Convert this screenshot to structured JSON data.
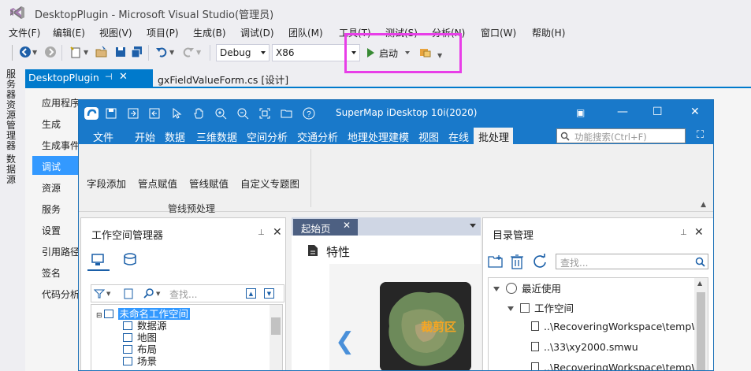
{
  "vs": {
    "title": "DesktopPlugin - Microsoft Visual Studio(管理员)",
    "menu": [
      "文件(F)",
      "编辑(E)",
      "视图(V)",
      "项目(P)",
      "生成(B)",
      "调试(D)",
      "团队(M)",
      "工具(T)",
      "测试(S)",
      "分析(N)",
      "窗口(W)",
      "帮助(H)"
    ],
    "toolbar": {
      "config": "Debug",
      "platform": "X86",
      "run_label": "启动"
    },
    "side_toolbox": [
      "服务器资源管理器",
      "数据源"
    ],
    "tabs": {
      "active": "DesktopPlugin",
      "other": "gxFieldValueForm.cs [设计]"
    },
    "project_nav": [
      "应用程序",
      "生成",
      "生成事件",
      "调试",
      "资源",
      "服务",
      "设置",
      "引用路径",
      "签名",
      "代码分析"
    ],
    "project_nav_selected": 3
  },
  "supermap": {
    "title": "SuperMap iDesktop 10i(2020)",
    "ribbon_tabs": [
      "文件",
      "开始",
      "数据",
      "三维数据",
      "空间分析",
      "交通分析",
      "地理处理建模",
      "视图",
      "在线"
    ],
    "active_tab": "批处理",
    "function_search_placeholder": "功能搜索(Ctrl+F)",
    "ribbon_buttons": [
      "字段添加",
      "管点赋值",
      "管线赋值",
      "自定义专题图"
    ],
    "ribbon_group": "管线预处理",
    "workspace_pane": {
      "title": "工作空间管理器",
      "search_placeholder": "查找...",
      "tree": {
        "root": "未命名工作空间",
        "children": [
          "数据源",
          "地图",
          "布局",
          "场景"
        ]
      }
    },
    "start_page": {
      "tab": "起始页",
      "properties_label": "特性",
      "thumbnail_label": "裁剪区"
    },
    "catalog_pane": {
      "title": "目录管理",
      "search_placeholder": "查找...",
      "recent": "最近使用",
      "workspace_group": "工作空间",
      "files": [
        "..\\RecoveringWorkspace\\tempW...",
        "..\\33\\xy2000.smwu",
        "..\\RecoveringWorkspace\\tempW..."
      ]
    }
  },
  "colors": {
    "vs_accent": "#007acc",
    "supermap_blue": "#1979ca",
    "highlight": "#e83ee8",
    "selection": "#3399ff"
  }
}
